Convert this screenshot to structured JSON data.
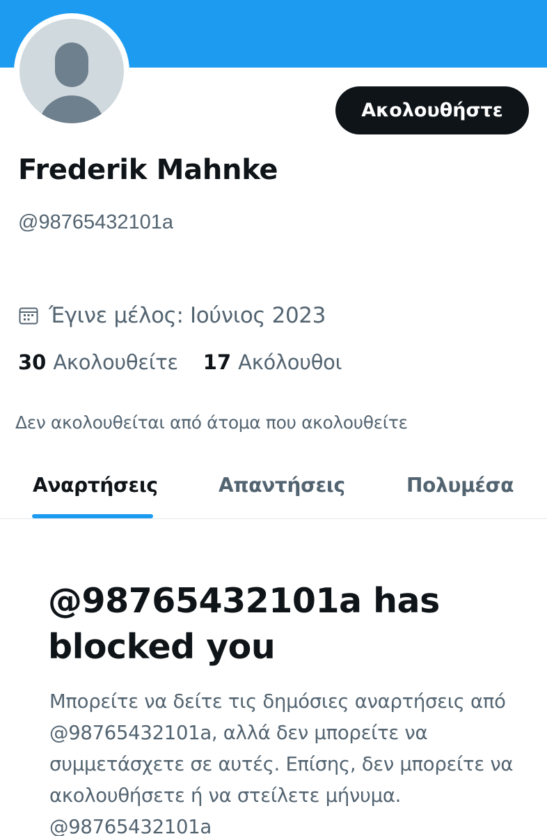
{
  "colors": {
    "banner": "#1d9bf0",
    "accent": "#1d9bf0",
    "primary_text": "#0f1419",
    "secondary_text": "#536471",
    "avatar_bg": "#cfd9de"
  },
  "profile": {
    "avatar_icon": "default-avatar-icon",
    "follow_label": "Ακολουθήστε",
    "display_name": "Frederik Mahnke",
    "handle": "@98765432101a",
    "joined_icon": "calendar-icon",
    "joined_text": "Έγινε μέλος: Ιούνιος 2023",
    "following_count": "30",
    "following_label": "Ακολουθείτε",
    "followers_count": "17",
    "followers_label": "Ακόλουθοι",
    "followed_by_text": "Δεν ακολουθείται από άτομα που ακολουθείτε"
  },
  "tabs": [
    {
      "label": "Αναρτήσεις",
      "active": true
    },
    {
      "label": "Απαντήσεις",
      "active": false
    },
    {
      "label": "Πολυμέσα",
      "active": false
    }
  ],
  "blocked": {
    "title": "@98765432101a has blocked you",
    "body": "Μπορείτε να δείτε τις δημόσιες αναρτήσεις από @98765432101a, αλλά δεν μπορείτε να συμμετάσχετε σε αυτές. Επίσης, δεν μπορείτε να ακολουθήσετε ή να στείλετε μήνυμα. @98765432101a"
  }
}
